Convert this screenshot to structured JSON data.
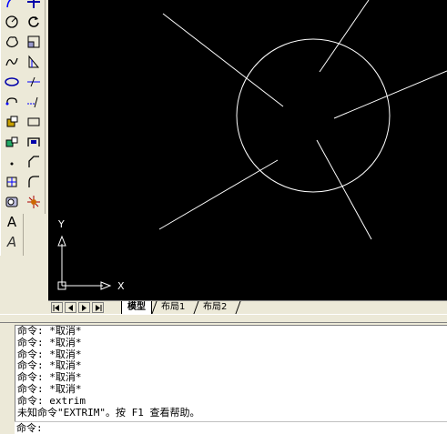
{
  "draw_toolbar": {
    "text_tool_glyph": "A",
    "mtext_tool_glyph": "A"
  },
  "layout_tabs": {
    "model": "模型",
    "layout1": "布局1",
    "layout2": "布局2"
  },
  "ucs": {
    "x_label": "X",
    "y_label": "Y"
  },
  "command_history": [
    "命令: *取消*",
    "命令: *取消*",
    "命令: *取消*",
    "命令: *取消*",
    "命令: *取消*",
    "命令: *取消*",
    "命令: extrim",
    "未知命令\"EXTRIM\"。按 F1 查看帮助。"
  ],
  "command_prompt": "命令:",
  "colors": {
    "viewport_bg": "#000000",
    "drawing_stroke": "#ffffff",
    "ui_face": "#ece9d8"
  }
}
